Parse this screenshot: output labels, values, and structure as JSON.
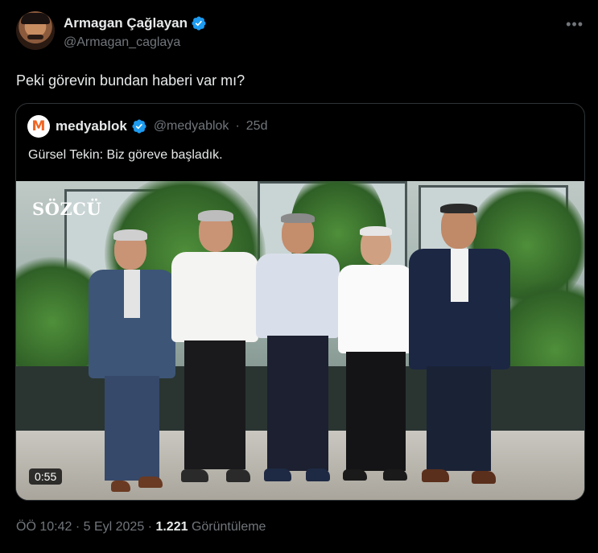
{
  "author": {
    "display_name": "Armagan Çağlayan",
    "handle": "@Armagan_caglaya"
  },
  "tweet": {
    "text": "Peki görevin bundan haberi var mı?"
  },
  "quoted": {
    "logo_letter": "M",
    "name": "medyablok",
    "handle": "@medyablok",
    "separator": "·",
    "age": "25d",
    "text": "Gürsel Tekin: Biz göreve başladık.",
    "video": {
      "watermark": "SÖZCÜ",
      "duration": "0:55"
    }
  },
  "footer": {
    "time": "ÖÖ 10:42",
    "dot1": "·",
    "date": "5 Eyl 2025",
    "dot2": "·",
    "views_count": "1.221",
    "views_label": "Görüntüleme"
  },
  "icons": {
    "verified": "verified-badge-icon",
    "more": "more-options-icon"
  },
  "colors": {
    "background": "#000000",
    "text": "#e7e9ea",
    "muted": "#71767b",
    "verified": "#1d9bf0",
    "border": "#2f3336",
    "brand_orange": "#f26522"
  }
}
